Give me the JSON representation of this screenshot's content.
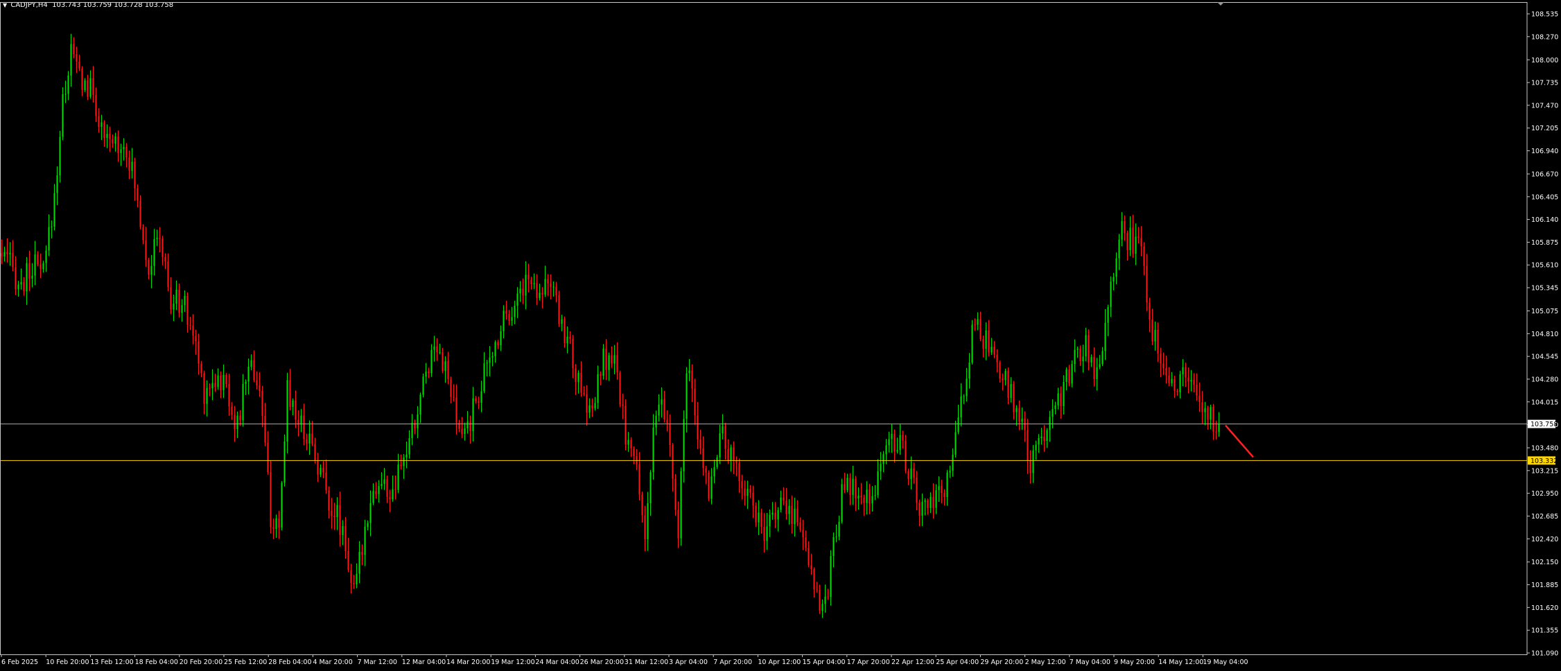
{
  "header": {
    "symbol_timeframe": "CADJPY,H4",
    "ohlc": "103.743 103.759 103.728 103.758",
    "menu_icon": "triangle-down-icon"
  },
  "colors": {
    "background": "#000000",
    "bull": "#00e000",
    "bear": "#ff1a1a",
    "axis_text": "#ffffff",
    "bid_line": "#a9a9a9",
    "level_line": "#ffd700",
    "arrow": "#ff2020"
  },
  "chart_data": {
    "type": "candlestick",
    "title": "CADJPY,H4",
    "y_ticks": [
      "108.535",
      "108.270",
      "108.000",
      "107.735",
      "107.470",
      "107.205",
      "106.940",
      "106.670",
      "106.405",
      "106.140",
      "105.875",
      "105.610",
      "105.345",
      "105.075",
      "104.810",
      "104.545",
      "104.280",
      "104.015",
      "103.750",
      "103.480",
      "103.215",
      "102.950",
      "102.685",
      "102.420",
      "102.150",
      "101.885",
      "101.620",
      "101.355",
      "101.090"
    ],
    "x_ticks": [
      "6 Feb 2025",
      "10 Feb 20:00",
      "13 Feb 12:00",
      "18 Feb 04:00",
      "20 Feb 20:00",
      "25 Feb 12:00",
      "28 Feb 04:00",
      "4 Mar 20:00",
      "7 Mar 12:00",
      "12 Mar 04:00",
      "14 Mar 20:00",
      "19 Mar 12:00",
      "24 Mar 04:00",
      "26 Mar 20:00",
      "31 Mar 12:00",
      "3 Apr 04:00",
      "7 Apr 20:00",
      "10 Apr 12:00",
      "15 Apr 04:00",
      "17 Apr 20:00",
      "22 Apr 12:00",
      "25 Apr 04:00",
      "29 Apr 20:00",
      "2 May 12:00",
      "7 May 04:00",
      "9 May 20:00",
      "14 May 12:00",
      "19 May 04:00"
    ],
    "ylim": [
      101.09,
      108.6
    ],
    "current_price": "103.758",
    "level_price": "103.332",
    "anchors": [
      [
        0,
        105.75
      ],
      [
        4,
        105.6
      ],
      [
        8,
        105.35
      ],
      [
        12,
        105.6
      ],
      [
        16,
        105.5
      ],
      [
        20,
        106.4
      ],
      [
        23,
        107.5
      ],
      [
        26,
        108.1
      ],
      [
        30,
        107.75
      ],
      [
        34,
        107.6
      ],
      [
        38,
        107.0
      ],
      [
        42,
        107.05
      ],
      [
        46,
        107.0
      ],
      [
        50,
        106.35
      ],
      [
        54,
        105.6
      ],
      [
        58,
        105.95
      ],
      [
        62,
        105.15
      ],
      [
        66,
        105.2
      ],
      [
        70,
        104.8
      ],
      [
        74,
        104.15
      ],
      [
        78,
        104.3
      ],
      [
        82,
        104.2
      ],
      [
        86,
        103.7
      ],
      [
        90,
        104.5
      ],
      [
        94,
        104.2
      ],
      [
        98,
        102.7
      ],
      [
        101,
        102.4
      ],
      [
        104,
        104.2
      ],
      [
        108,
        103.8
      ],
      [
        112,
        103.6
      ],
      [
        116,
        103.2
      ],
      [
        120,
        102.8
      ],
      [
        124,
        102.55
      ],
      [
        128,
        101.75
      ],
      [
        131,
        102.35
      ],
      [
        134,
        102.95
      ],
      [
        138,
        103.05
      ],
      [
        142,
        102.9
      ],
      [
        146,
        103.35
      ],
      [
        150,
        103.75
      ],
      [
        154,
        104.4
      ],
      [
        158,
        104.75
      ],
      [
        162,
        104.25
      ],
      [
        166,
        103.6
      ],
      [
        170,
        103.8
      ],
      [
        174,
        104.25
      ],
      [
        178,
        104.55
      ],
      [
        182,
        105.05
      ],
      [
        186,
        105.15
      ],
      [
        190,
        105.45
      ],
      [
        194,
        105.35
      ],
      [
        198,
        105.45
      ],
      [
        202,
        105.0
      ],
      [
        206,
        104.65
      ],
      [
        210,
        104.05
      ],
      [
        214,
        103.9
      ],
      [
        218,
        104.5
      ],
      [
        222,
        104.45
      ],
      [
        226,
        103.65
      ],
      [
        230,
        103.2
      ],
      [
        233,
        102.5
      ],
      [
        236,
        103.6
      ],
      [
        239,
        104.0
      ],
      [
        242,
        103.5
      ],
      [
        245,
        102.35
      ],
      [
        248,
        104.5
      ],
      [
        252,
        103.55
      ],
      [
        256,
        103.0
      ],
      [
        260,
        103.65
      ],
      [
        264,
        103.35
      ],
      [
        268,
        103.1
      ],
      [
        272,
        102.85
      ],
      [
        276,
        102.35
      ],
      [
        280,
        102.8
      ],
      [
        284,
        102.75
      ],
      [
        288,
        102.7
      ],
      [
        292,
        102.2
      ],
      [
        295,
        101.8
      ],
      [
        298,
        101.6
      ],
      [
        301,
        102.4
      ],
      [
        304,
        102.95
      ],
      [
        308,
        103.0
      ],
      [
        312,
        102.8
      ],
      [
        316,
        103.05
      ],
      [
        320,
        103.5
      ],
      [
        324,
        103.6
      ],
      [
        328,
        103.25
      ],
      [
        332,
        102.75
      ],
      [
        336,
        102.8
      ],
      [
        340,
        102.9
      ],
      [
        344,
        103.35
      ],
      [
        348,
        104.2
      ],
      [
        352,
        104.95
      ],
      [
        356,
        104.7
      ],
      [
        360,
        104.35
      ],
      [
        364,
        104.2
      ],
      [
        368,
        103.85
      ],
      [
        372,
        103.25
      ],
      [
        376,
        103.6
      ],
      [
        380,
        104.0
      ],
      [
        384,
        104.15
      ],
      [
        388,
        104.5
      ],
      [
        392,
        104.7
      ],
      [
        396,
        104.3
      ],
      [
        400,
        105.2
      ],
      [
        404,
        106.05
      ],
      [
        408,
        105.9
      ],
      [
        412,
        105.8
      ],
      [
        416,
        104.85
      ],
      [
        420,
        104.5
      ],
      [
        424,
        104.2
      ],
      [
        428,
        104.35
      ],
      [
        432,
        104.05
      ],
      [
        436,
        103.85
      ],
      [
        439,
        103.76
      ]
    ],
    "annotation": "red down arrow projection from last candle"
  }
}
